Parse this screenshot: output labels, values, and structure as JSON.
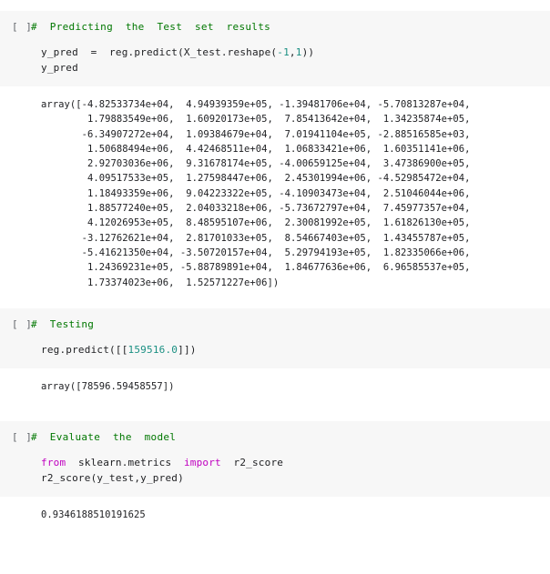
{
  "notebook": {
    "prompt_label": "[ ]",
    "colors": {
      "cell_background": "#f7f7f7",
      "page_background": "#ffffff",
      "comment": "#007700",
      "keyword": "#c000c0",
      "number": "#1a8f82",
      "text": "#202124",
      "prompt": "#5f6368"
    },
    "cells": [
      {
        "id": "cell-predicting",
        "comment": "#  Predicting  the  Test  set  results",
        "code_lines": [
          {
            "segments": [
              {
                "text": "y_pred  =  reg.predict(X_test.reshape(",
                "type": "plain"
              },
              {
                "text": "-1",
                "type": "number"
              },
              {
                "text": ",",
                "type": "plain"
              },
              {
                "text": "1",
                "type": "number"
              },
              {
                "text": "))",
                "type": "plain"
              }
            ]
          },
          {
            "segments": [
              {
                "text": "y_pred",
                "type": "plain"
              }
            ]
          }
        ],
        "output_lines": [
          "array([-4.82533734e+04,  4.94939359e+05, -1.39481706e+04, -5.70813287e+04,",
          "        1.79883549e+06,  1.60920173e+05,  7.85413642e+04,  1.34235874e+05,",
          "       -6.34907272e+04,  1.09384679e+04,  7.01941104e+05, -2.88516585e+03,",
          "        1.50688494e+06,  4.42468511e+04,  1.06833421e+06,  1.60351141e+06,",
          "        2.92703036e+06,  9.31678174e+05, -4.00659125e+04,  3.47386900e+05,",
          "        4.09517533e+05,  1.27598447e+06,  2.45301994e+06, -4.52985472e+04,",
          "        1.18493359e+06,  9.04223322e+05, -4.10903473e+04,  2.51046044e+06,",
          "        1.88577240e+05,  2.04033218e+06, -5.73672797e+04,  7.45977357e+04,",
          "        4.12026953e+05,  8.48595107e+06,  2.30081992e+05,  1.61826130e+05,",
          "       -3.12762621e+04,  2.81701033e+05,  8.54667403e+05,  1.43455787e+05,",
          "       -5.41621350e+04, -3.50720157e+04,  5.29794193e+05,  1.82335066e+06,",
          "        1.24369231e+05, -5.88789891e+04,  1.84677636e+06,  6.96585537e+05,",
          "        1.73374023e+06,  1.52571227e+06])"
        ]
      },
      {
        "id": "cell-testing",
        "comment": "#  Testing",
        "code_lines": [
          {
            "segments": [
              {
                "text": "reg.predict([[",
                "type": "plain"
              },
              {
                "text": "159516.0",
                "type": "number"
              },
              {
                "text": "]])",
                "type": "plain"
              }
            ]
          }
        ],
        "output_lines": [
          "array([78596.59458557])"
        ]
      },
      {
        "id": "cell-evaluate",
        "comment": "#  Evaluate  the  model",
        "code_lines": [
          {
            "segments": [
              {
                "text": "from",
                "type": "keyword"
              },
              {
                "text": "  sklearn.metrics  ",
                "type": "plain"
              },
              {
                "text": "import",
                "type": "keyword"
              },
              {
                "text": "  r2_score",
                "type": "plain"
              }
            ]
          },
          {
            "segments": [
              {
                "text": "r2_score(y_test,y_pred)",
                "type": "plain"
              }
            ]
          }
        ],
        "output_lines": [
          "0.9346188510191625"
        ]
      }
    ]
  }
}
